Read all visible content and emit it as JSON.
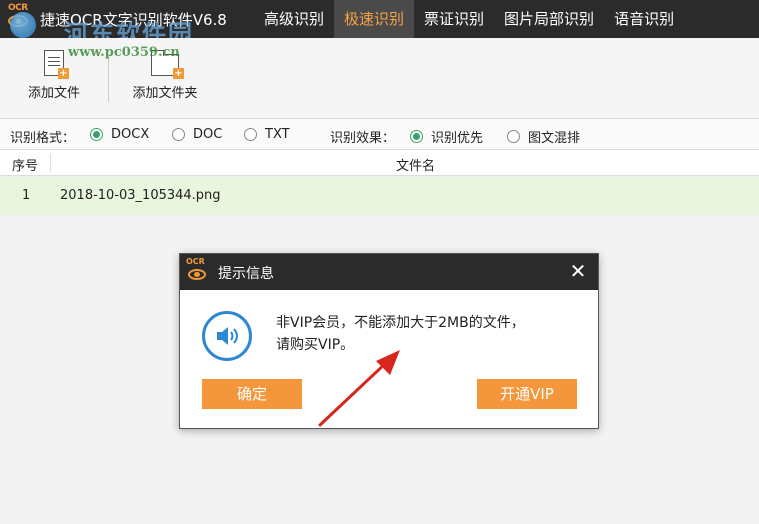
{
  "app": {
    "logo_text": "OCR",
    "title": "捷速OCR文字识别软件V6.8"
  },
  "nav": {
    "tabs": [
      {
        "label": "高级识别"
      },
      {
        "label": "极速识别"
      },
      {
        "label": "票证识别"
      },
      {
        "label": "图片局部识别"
      },
      {
        "label": "语音识别"
      }
    ],
    "active_index": 1
  },
  "watermark": {
    "text": "河东软件园",
    "url": "www.pc0359.cn"
  },
  "toolbar": {
    "add_file_label": "添加文件",
    "add_folder_label": "添加文件夹"
  },
  "options": {
    "format_label": "识别格式：",
    "formats": [
      {
        "label": "DOCX",
        "checked": true
      },
      {
        "label": "DOC",
        "checked": false
      },
      {
        "label": "TXT",
        "checked": false
      }
    ],
    "effect_label": "识别效果：",
    "effects": [
      {
        "label": "识别优先",
        "checked": true
      },
      {
        "label": "图文混排",
        "checked": false
      }
    ]
  },
  "table": {
    "columns": [
      "序号",
      "文件名"
    ],
    "rows": [
      {
        "index": "1",
        "filename": "2018-10-03_105344.png"
      }
    ]
  },
  "dialog": {
    "title": "提示信息",
    "close_glyph": "✕",
    "message_line1": "非VIP会员，不能添加大于2MB的文件，",
    "message_line2": "请购买VIP。",
    "confirm_label": "确定",
    "vip_label": "开通VIP"
  },
  "colors": {
    "accent": "#f4963c",
    "titlebar": "#2b2b2b",
    "selected_row": "#e9f5dc",
    "radio_checked": "#3aa06b",
    "speaker": "#2e86d6",
    "annotation_arrow": "#d9261c"
  }
}
